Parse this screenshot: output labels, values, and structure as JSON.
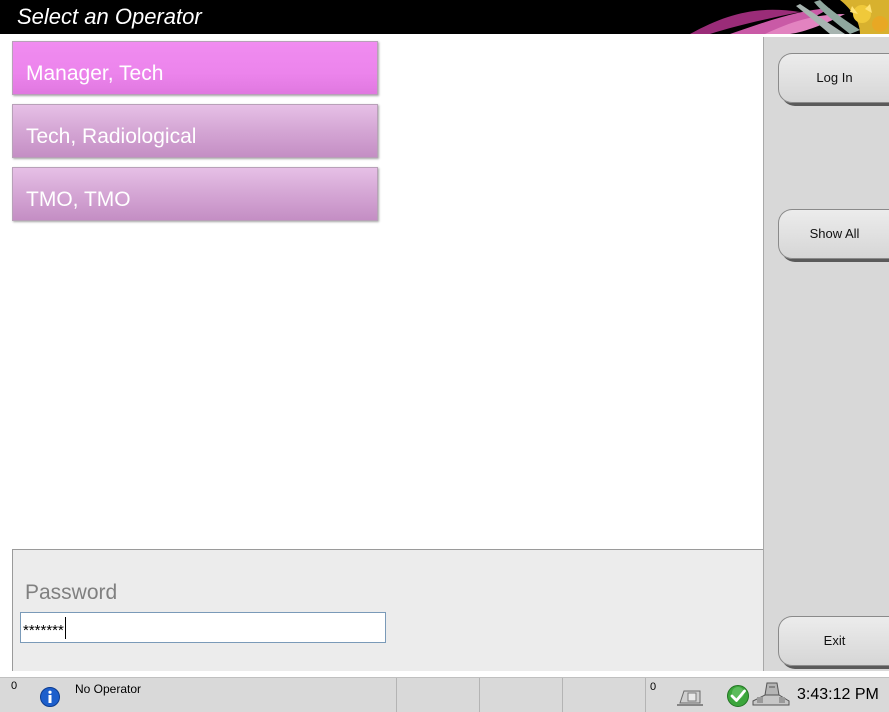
{
  "window": {
    "title": "Select an Operator"
  },
  "operators": [
    {
      "label": "Manager, Tech",
      "selected": true
    },
    {
      "label": "Tech, Radiological",
      "selected": false
    },
    {
      "label": "TMO, TMO",
      "selected": false
    }
  ],
  "side_buttons": {
    "login": "Log In",
    "show_all": "Show All",
    "exit": "Exit"
  },
  "password": {
    "label": "Password",
    "value": "*******"
  },
  "statusbar": {
    "left_count": "0",
    "operator_status": "No Operator",
    "right_count": "0",
    "time": "3:43:12 PM",
    "icons": [
      "info-icon",
      "tube-icon",
      "check-icon",
      "gantry-icon"
    ]
  },
  "colors": {
    "selected_operator": "#ec84ec",
    "operator": "#d6a8d6",
    "title_bar": "#000000",
    "side_panel": "#d8d8d8",
    "status_bar": "#d9d9d9",
    "info_icon": "#1d5fcc",
    "check_icon": "#3ca63c"
  }
}
